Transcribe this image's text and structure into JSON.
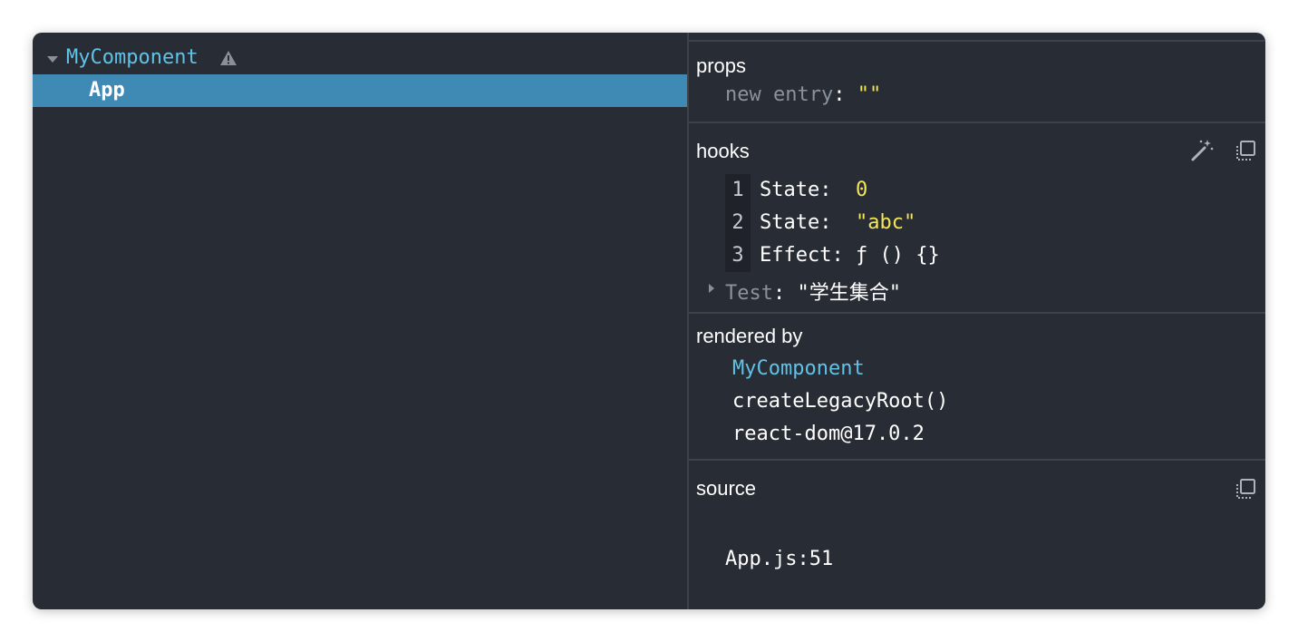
{
  "tree": {
    "items": [
      {
        "label": "MyComponent",
        "expanded": true,
        "warning_icon": "warning-triangle-icon"
      },
      {
        "label": "App",
        "selected": true
      }
    ]
  },
  "props": {
    "title": "props",
    "new_entry_key": "new entry",
    "new_entry_value": "\"\""
  },
  "hooks": {
    "title": "hooks",
    "icons": [
      "magic-wand-icon",
      "copy-icon"
    ],
    "items": [
      {
        "index": "1",
        "name": "State",
        "value": "0"
      },
      {
        "index": "2",
        "name": "State",
        "value": "\"abc\""
      },
      {
        "index": "3",
        "name": "Effect",
        "value": "ƒ () {}"
      }
    ],
    "custom": {
      "name": "Test",
      "value": "\"学生集合\""
    }
  },
  "rendered_by": {
    "title": "rendered by",
    "owner": "MyComponent",
    "items": [
      "createLegacyRoot()",
      "react-dom@17.0.2"
    ]
  },
  "source": {
    "title": "source",
    "location": "App.js:51",
    "icon": "copy-icon"
  },
  "colors": {
    "background": "#282c34",
    "selected_row": "#3f89b5",
    "component_name": "#61c2e8",
    "string_value": "#f5e653",
    "key_grey": "#8c929b"
  }
}
